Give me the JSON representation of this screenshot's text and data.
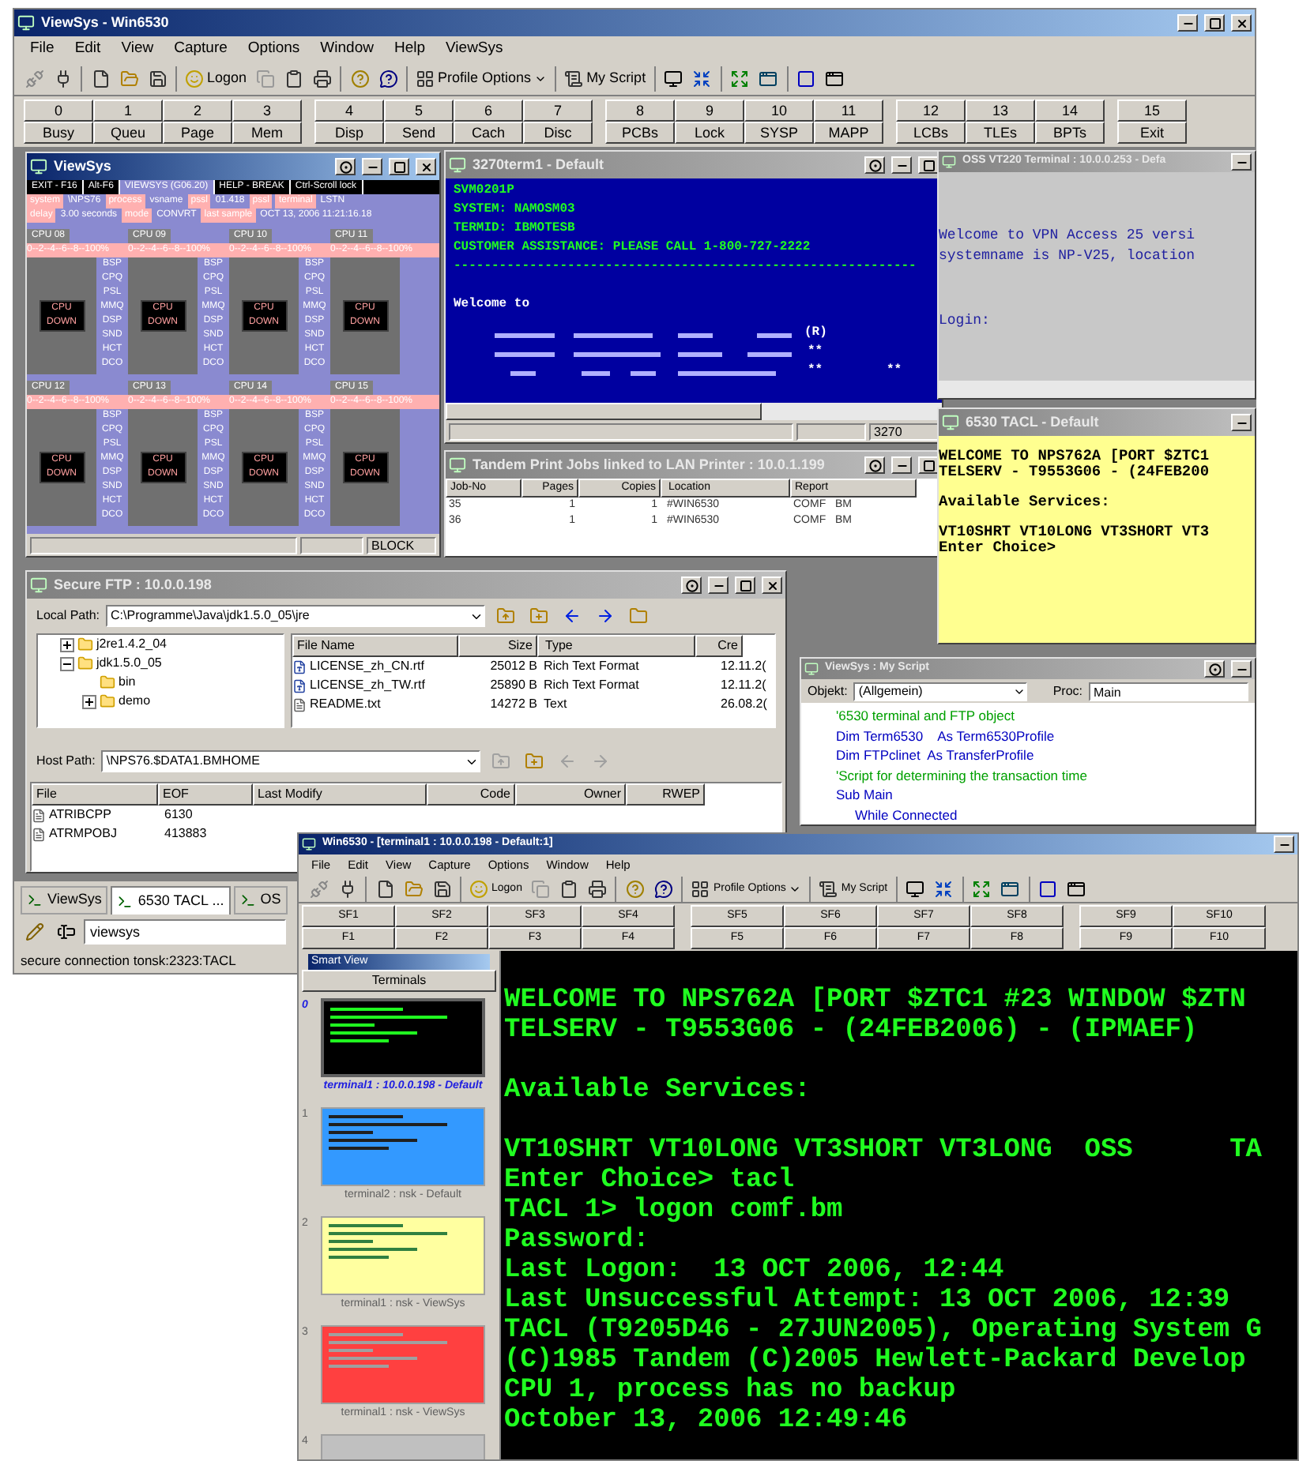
{
  "main_window": {
    "title": "ViewSys - Win6530",
    "active": true,
    "menu": [
      "File",
      "Edit",
      "View",
      "Capture",
      "Options",
      "Window",
      "Help",
      "ViewSys"
    ],
    "toolbar": {
      "logon": "Logon",
      "profile_options": "Profile Options",
      "my_script": "My Script"
    },
    "function_key_groups": [
      [
        {
          "number": "0",
          "label": "Busy"
        },
        {
          "number": "1",
          "label": "Queu"
        },
        {
          "number": "2",
          "label": "Page"
        },
        {
          "number": "3",
          "label": "Mem"
        }
      ],
      [
        {
          "number": "4",
          "label": "Disp"
        },
        {
          "number": "5",
          "label": "Send"
        },
        {
          "number": "6",
          "label": "Cach"
        },
        {
          "number": "7",
          "label": "Disc"
        }
      ],
      [
        {
          "number": "8",
          "label": "PCBs"
        },
        {
          "number": "9",
          "label": "Lock"
        },
        {
          "number": "10",
          "label": "SYSP"
        },
        {
          "number": "11",
          "label": "MAPP"
        }
      ],
      [
        {
          "number": "12",
          "label": "LCBs"
        },
        {
          "number": "13",
          "label": "TLEs"
        },
        {
          "number": "14",
          "label": "BPTs"
        }
      ],
      [
        {
          "number": "15",
          "label": "Exit"
        }
      ]
    ],
    "viewsys": {
      "title": "ViewSys",
      "active": true,
      "header_keys": [
        "EXIT - F16",
        "Alt-F6",
        "VIEWSYS (G06.20)",
        "HELP - BREAK",
        "Ctrl-Scroll lock"
      ],
      "info_rows": [
        [
          {
            "kind": "label",
            "text": "system"
          },
          {
            "kind": "value",
            "text": "\\NPS76"
          },
          {
            "kind": "label",
            "text": "process"
          },
          {
            "kind": "value",
            "text": "vsname"
          },
          {
            "kind": "label",
            "text": "pssl"
          },
          {
            "kind": "value",
            "text": "01.418"
          },
          {
            "kind": "label",
            "text": "pssl"
          },
          {
            "kind": "label",
            "text": "terminal"
          },
          {
            "kind": "value",
            "text": "LSTN"
          }
        ],
        [
          {
            "kind": "label",
            "text": "delay"
          },
          {
            "kind": "value",
            "text": "3.00 seconds"
          },
          {
            "kind": "label",
            "text": "mode"
          },
          {
            "kind": "value",
            "text": "CONVRT"
          },
          {
            "kind": "label",
            "text": "last sample"
          },
          {
            "kind": "value",
            "text": "OCT 13, 2006 11:21:16.18"
          }
        ]
      ],
      "cpu_rows": [
        [
          {
            "label": "CPU 08",
            "scale": "0--2--4--6--8--100%",
            "status": [
              "CPU",
              "DOWN"
            ],
            "metrics": [
              "BSP",
              "CPQ",
              "PSL",
              "MMQ",
              "DSP",
              "SND",
              "HCT",
              "DCO"
            ]
          },
          {
            "label": "CPU 09",
            "scale": "0--2--4--6--8--100%",
            "status": [
              "CPU",
              "DOWN"
            ],
            "metrics": [
              "BSP",
              "CPQ",
              "PSL",
              "MMQ",
              "DSP",
              "SND",
              "HCT",
              "DCO"
            ]
          },
          {
            "label": "CPU 10",
            "scale": "0--2--4--6--8--100%",
            "status": [
              "CPU",
              "DOWN"
            ],
            "metrics": [
              "BSP",
              "CPQ",
              "PSL",
              "MMQ",
              "DSP",
              "SND",
              "HCT",
              "DCO"
            ]
          },
          {
            "label": "CPU 11",
            "scale": "0--2--4--6--8--100%",
            "status": [
              "CPU",
              "DOWN"
            ]
          }
        ],
        [
          {
            "label": "CPU 12",
            "scale": "0--2--4--6--8--100%",
            "status": [
              "CPU",
              "DOWN"
            ],
            "metrics": [
              "BSP",
              "CPQ",
              "PSL",
              "MMQ",
              "DSP",
              "SND",
              "HCT",
              "DCO"
            ]
          },
          {
            "label": "CPU 13",
            "scale": "0--2--4--6--8--100%",
            "status": [
              "CPU",
              "DOWN"
            ],
            "metrics": [
              "BSP",
              "CPQ",
              "PSL",
              "MMQ",
              "DSP",
              "SND",
              "HCT",
              "DCO"
            ]
          },
          {
            "label": "CPU 14",
            "scale": "0--2--4--6--8--100%",
            "status": [
              "CPU",
              "DOWN"
            ],
            "metrics": [
              "BSP",
              "CPQ",
              "PSL",
              "MMQ",
              "DSP",
              "SND",
              "HCT",
              "DCO"
            ]
          },
          {
            "label": "CPU 15",
            "scale": "0--2--4--6--8--100%",
            "status": [
              "CPU",
              "DOWN"
            ]
          }
        ]
      ],
      "status_bar": "BLOCK"
    },
    "term3270": {
      "title": "3270term1 - Default",
      "active": false,
      "lines": [
        "SVM0201P",
        "SYSTEM: NAMOSM03",
        "TERMID: IBMOTESB",
        "CUSTOMER ASSISTANCE: PLEASE CALL 1-800-727-2222",
        "-------------------------------------------------------------"
      ],
      "welcome": "Welcome to",
      "logo_marks": [
        "(R)",
        "**",
        "**",
        "**"
      ],
      "status_bar": "3270"
    },
    "print_jobs": {
      "title": "Tandem Print Jobs linked to LAN Printer : 10.0.1.199",
      "active": false,
      "columns": [
        "Job-No",
        "Pages",
        "Copies",
        "Location",
        "Report"
      ],
      "rows": [
        [
          "35",
          "1",
          "1",
          "#WIN6530",
          "COMF   BM"
        ],
        [
          "36",
          "1",
          "1",
          "#WIN6530",
          "COMF   BM"
        ]
      ]
    },
    "vt220": {
      "title": "OSS VT220 Terminal : 10.0.0.253 - Defa",
      "active": false,
      "lines": [
        "Welcome to VPN Access 25 versi",
        "systemname is NP-V25, location"
      ],
      "prompt": "Login:"
    },
    "tacl": {
      "title": "6530 TACL - Default",
      "active": false,
      "blocks": [
        [
          "WELCOME TO NPS762A [PORT $ZTC1",
          "TELSERV - T9553G06 - (24FEB200"
        ],
        [
          "Available Services:"
        ],
        [
          "VT10SHRT VT10LONG VT3SHORT VT3",
          "Enter Choice>"
        ]
      ]
    },
    "ftp": {
      "title": "Secure FTP : 10.0.0.198",
      "active": false,
      "local_path_label": "Local Path:",
      "local_path": "C:\\Programme\\Java\\jdk1.5.0_05\\jre",
      "tree": [
        {
          "label": "j2re1.4.2_04",
          "expanded": false
        },
        {
          "label": "jdk1.5.0_05",
          "expanded": true,
          "children": [
            {
              "label": "bin"
            },
            {
              "label": "demo",
              "expanded": false
            }
          ]
        }
      ],
      "file_columns": [
        "File Name",
        "Size",
        "Type",
        "Cre"
      ],
      "files": [
        {
          "kind": "rtf",
          "name": "LICENSE_zh_CN.rtf",
          "size": "25012 B",
          "type": "Rich Text Format",
          "created": "12.11.2("
        },
        {
          "kind": "rtf",
          "name": "LICENSE_zh_TW.rtf",
          "size": "25890 B",
          "type": "Rich Text Format",
          "created": "12.11.2("
        },
        {
          "kind": "text",
          "name": "README.txt",
          "size": "14272 B",
          "type": "Text",
          "created": "26.08.2("
        }
      ],
      "host_path_label": "Host Path:",
      "host_path": "\\NPS76.$DATA1.BMHOME",
      "host_columns": [
        "File",
        "EOF",
        "Last Modify",
        "Code",
        "Owner",
        "RWEP"
      ],
      "host_files": [
        {
          "name": "ATRIBCPP",
          "eof": "6130"
        },
        {
          "name": "ATRMPOBJ",
          "eof": "413883"
        }
      ]
    },
    "script": {
      "title": "ViewSys : My Script",
      "active": false,
      "object_label": "Objekt:",
      "object": "(Allgemein)",
      "proc_label": "Proc:",
      "proc": "Main",
      "lines": [
        {
          "kind": "comment",
          "text": "'6530 terminal and FTP object"
        },
        {
          "kind": "code",
          "text": "Dim Term6530    As Term6530Profile"
        },
        {
          "kind": "code",
          "text": "Dim FTPclinet  As TransferProfile"
        },
        {
          "kind": "comment",
          "text": "'Script for determining the transaction time"
        },
        {
          "kind": "code",
          "text": "Sub Main",
          "children": [
            {
              "kind": "code",
              "text": "While Connected"
            }
          ]
        }
      ]
    },
    "tabs": [
      {
        "label": "ViewSys",
        "selected": false
      },
      {
        "label": "6530 TACL ...",
        "selected": true
      },
      {
        "label": "OS",
        "selected": false
      }
    ],
    "command_field": {
      "value": "viewsys"
    },
    "status_bar": "secure connection tonsk:2323:TACL"
  },
  "win6530": {
    "title": "Win6530 - [terminal1 : 10.0.0.198 - Default:1]",
    "active": true,
    "menu": [
      "File",
      "Edit",
      "View",
      "Capture",
      "Options",
      "Window",
      "Help"
    ],
    "toolbar": {
      "logon": "Logon",
      "profile_options": "Profile Options",
      "my_script": "My Script"
    },
    "function_key_groups": [
      [
        {
          "shift": "SF1",
          "key": "F1"
        },
        {
          "shift": "SF2",
          "key": "F2"
        },
        {
          "shift": "SF3",
          "key": "F3"
        },
        {
          "shift": "SF4",
          "key": "F4"
        }
      ],
      [
        {
          "shift": "SF5",
          "key": "F5"
        },
        {
          "shift": "SF6",
          "key": "F6"
        },
        {
          "shift": "SF7",
          "key": "F7"
        },
        {
          "shift": "SF8",
          "key": "F8"
        }
      ],
      [
        {
          "shift": "SF9",
          "key": "F9"
        },
        {
          "shift": "SF10",
          "key": "F10"
        }
      ]
    ],
    "smart_view": {
      "title": "Smart View",
      "heading": "Terminals",
      "items": [
        {
          "index": "0",
          "caption": "terminal1 : 10.0.0.198 - Default",
          "selected": true,
          "color": "#000000"
        },
        {
          "index": "1",
          "caption": "terminal2 : nsk - Default",
          "selected": false,
          "color": "#3399ff"
        },
        {
          "index": "2",
          "caption": "terminal1 : nsk - ViewSys",
          "selected": false,
          "color": "#ffffa0"
        },
        {
          "index": "3",
          "caption": "terminal1 : nsk - ViewSys",
          "selected": false,
          "color": "#ff4040"
        },
        {
          "index": "4",
          "selected": false,
          "color": "#c0c0c0"
        }
      ]
    },
    "terminal_blocks": [
      [
        "WELCOME TO NPS762A [PORT $ZTC1 #23 WINDOW $ZTN",
        "TELSERV - T9553G06 - (24FEB2006) - (IPMAEF)"
      ],
      [
        "Available Services:"
      ],
      [
        "VT10SHRT VT10LONG VT3SHORT VT3LONG  OSS      TA",
        "Enter Choice> tacl",
        "TACL 1> logon comf.bm",
        "Password:",
        "Last Logon:  13 OCT 2006, 12:44",
        "Last Unsuccessful Attempt: 13 OCT 2006, 12:39",
        "TACL (T9205D46 - 27JUN2005), Operating System G",
        "(C)1985 Tandem (C)2005 Hewlett-Packard Develop",
        "CPU 1, process has no backup",
        "October 13, 2006 12:49:46"
      ]
    ]
  }
}
